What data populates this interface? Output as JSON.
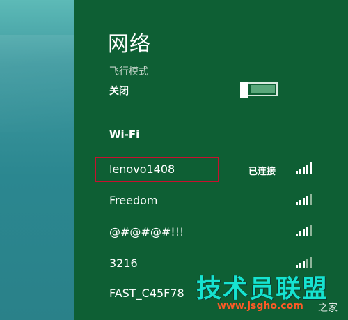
{
  "network_panel": {
    "title": "网络",
    "airplane_mode": {
      "label": "飞行模式",
      "state_text": "关闭"
    },
    "wifi": {
      "heading": "Wi-Fi",
      "networks": [
        {
          "ssid": "lenovo1408",
          "status": "已连接",
          "signal_bars": 4
        },
        {
          "ssid": "Freedom",
          "status": "",
          "signal_bars": 4
        },
        {
          "ssid": "@#@#@#!!!",
          "status": "",
          "signal_bars": 4
        },
        {
          "ssid": "3216",
          "status": "",
          "signal_bars": 3
        },
        {
          "ssid": "FAST_C45F78",
          "status": "",
          "signal_bars": 4
        }
      ]
    }
  },
  "watermark": {
    "site_name": "技术员联盟",
    "url": "www.jsgho.com",
    "tail": "之家"
  },
  "colors": {
    "panel_bg": "#0e5f34",
    "highlight_border": "#c8102e",
    "desktop": "#3f9aa0"
  }
}
